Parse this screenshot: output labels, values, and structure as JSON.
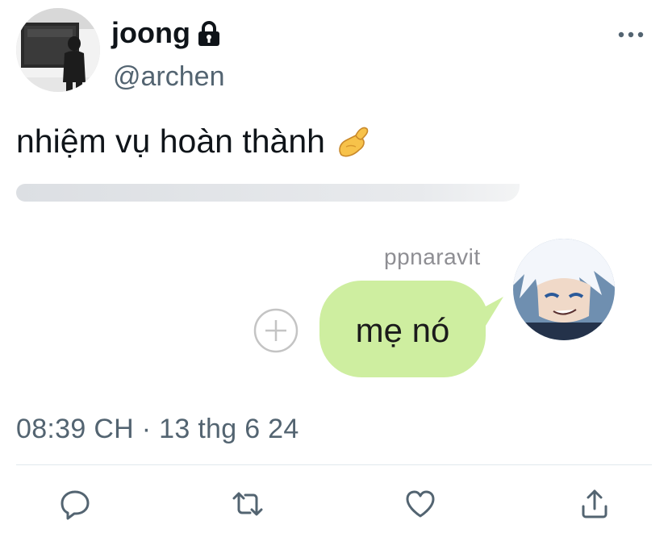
{
  "tweet": {
    "display_name": "joong",
    "handle": "@archen",
    "protected_icon": "lock-icon",
    "text": "nhiệm vụ hoàn thành",
    "text_emoji": "pinching-hand-emoji",
    "timestamp": "08:39 CH · 13 thg 6 24"
  },
  "media": {
    "chat_sender": "ppnaravit",
    "chat_message": "mẹ nó",
    "bubble_color": "#ceeea0",
    "add_icon": "plus-circle-icon"
  },
  "actions": {
    "icons": [
      "reply-icon",
      "retweet-icon",
      "like-icon",
      "share-icon"
    ]
  },
  "colors": {
    "primary_text": "#0f1419",
    "secondary_text": "#536471",
    "divider": "#e1e8ed"
  }
}
